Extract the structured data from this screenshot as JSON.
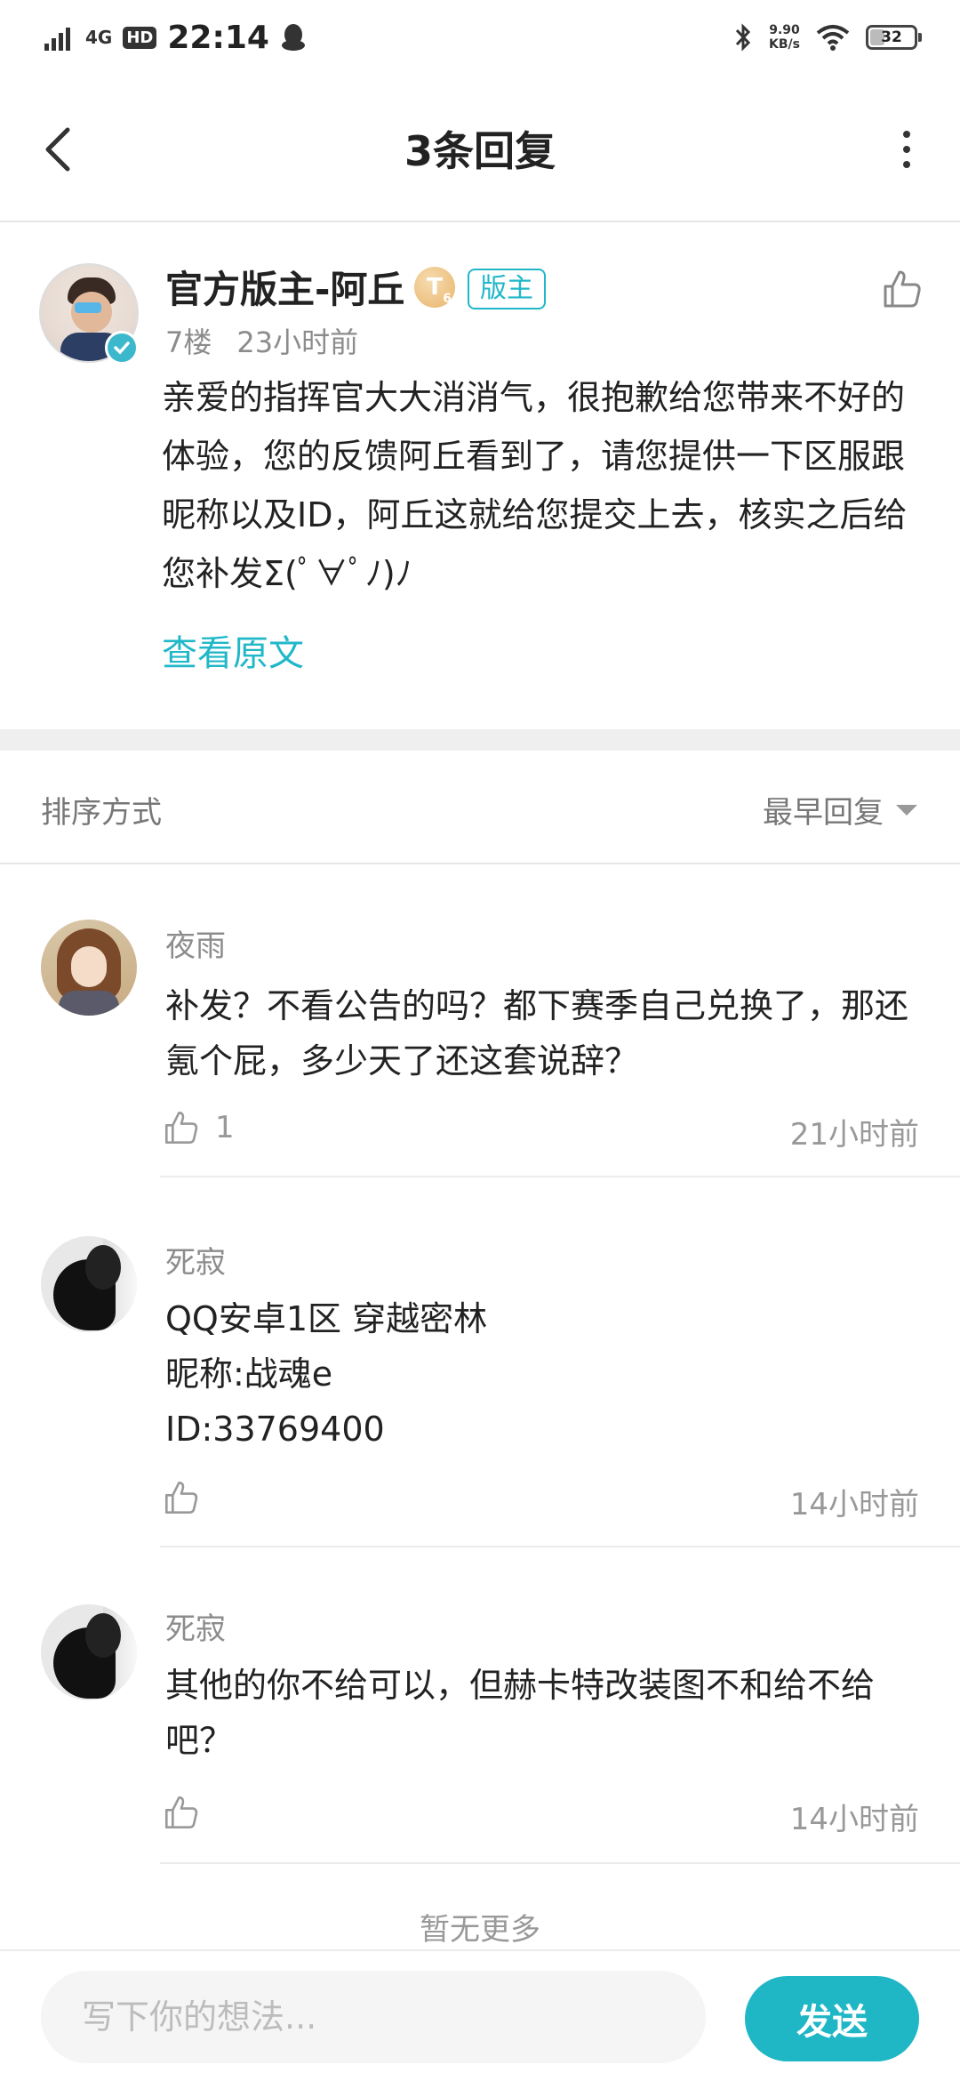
{
  "status_bar": {
    "network": "4G",
    "hd": "HD",
    "time": "22:14",
    "speed_value": "9.90",
    "speed_unit": "KB/s",
    "battery": "32"
  },
  "header": {
    "title": "3条回复"
  },
  "main_post": {
    "author": "官方版主-阿丘",
    "level": "T",
    "level_sub": "6",
    "role_tag": "版主",
    "floor": "7楼",
    "time": "23小时前",
    "content": "亲爱的指挥官大大消消气，很抱歉给您带来不好的体验，您的反馈阿丘看到了，请您提供一下区服跟昵称以及ID，阿丘这就给您提交上去，核实之后给您补发Σ(ﾟ∀ﾟﾉ)ﾉ",
    "view_original": "查看原文"
  },
  "sort": {
    "label": "排序方式",
    "selected": "最早回复"
  },
  "replies": [
    {
      "name": "夜雨",
      "text": "补发？不看公告的吗？都下赛季自己兑换了，那还氪个屁，多少天了还这套说辞？",
      "likes": "1",
      "time": "21小时前"
    },
    {
      "name": "死寂",
      "text": "QQ安卓1区 穿越密林\n昵称:战魂e\nID:33769400",
      "likes": "",
      "time": "14小时前"
    },
    {
      "name": "死寂",
      "text": "其他的你不给可以，但赫卡特改装图不和给不给吧？",
      "likes": "",
      "time": "14小时前"
    }
  ],
  "footer": {
    "no_more": "暂无更多",
    "input_placeholder": "写下你的想法...",
    "send_label": "发送"
  },
  "colors": {
    "accent": "#1fb6c6",
    "meta_text": "#8c8c8c"
  }
}
